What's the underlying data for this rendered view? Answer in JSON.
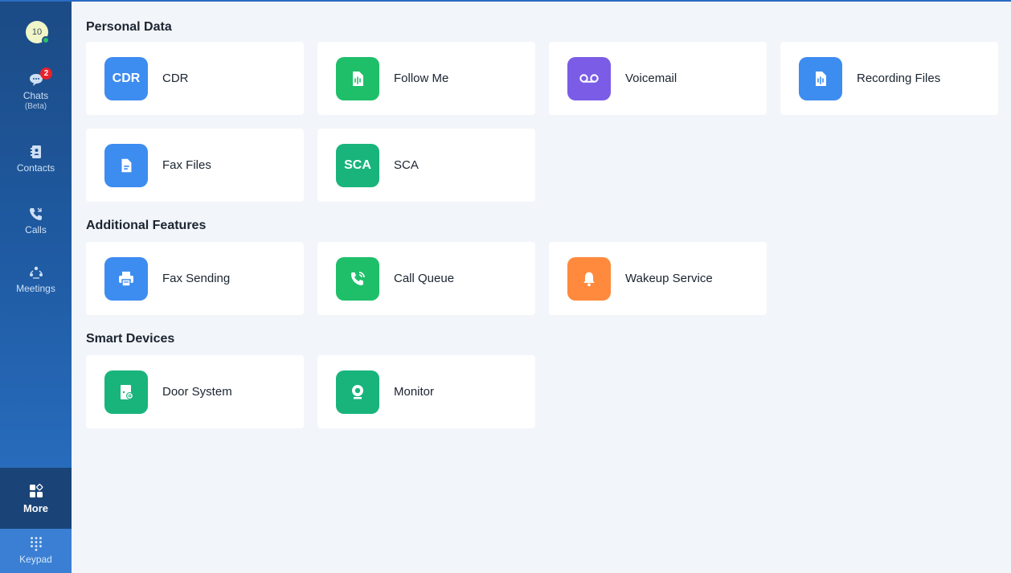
{
  "colors": {
    "blue": "#3d8cf0",
    "green": "#1fbf6a",
    "teal": "#18b47c",
    "purple": "#7b5ce6",
    "orange": "#ff8a3d"
  },
  "sidebar": {
    "avatar_text": "10",
    "chats": {
      "label": "Chats",
      "sub": "(Beta)",
      "badge": "2"
    },
    "contacts": {
      "label": "Contacts"
    },
    "calls": {
      "label": "Calls"
    },
    "meetings": {
      "label": "Meetings"
    },
    "more": {
      "label": "More"
    },
    "keypad": {
      "label": "Keypad"
    }
  },
  "sections": {
    "personal": {
      "title": "Personal Data",
      "items": [
        {
          "label": "CDR",
          "tile_text": "CDR",
          "icon": "cdr-text-icon",
          "color": "#3d8cf0"
        },
        {
          "label": "Follow Me",
          "icon": "follow-me-icon",
          "color": "#1fbf6a"
        },
        {
          "label": "Voicemail",
          "icon": "voicemail-icon",
          "color": "#7b5ce6"
        },
        {
          "label": "Recording Files",
          "icon": "recording-file-icon",
          "color": "#3d8cf0"
        },
        {
          "label": "Fax Files",
          "icon": "document-icon",
          "color": "#3d8cf0"
        },
        {
          "label": "SCA",
          "tile_text": "SCA",
          "icon": "sca-text-icon",
          "color": "#18b47c"
        }
      ]
    },
    "additional": {
      "title": "Additional Features",
      "items": [
        {
          "label": "Fax Sending",
          "icon": "printer-icon",
          "color": "#3d8cf0"
        },
        {
          "label": "Call Queue",
          "icon": "call-queue-icon",
          "color": "#1fbf6a"
        },
        {
          "label": "Wakeup Service",
          "icon": "bell-icon",
          "color": "#ff8a3d"
        }
      ]
    },
    "smart": {
      "title": "Smart Devices",
      "items": [
        {
          "label": "Door System",
          "icon": "door-icon",
          "color": "#18b47c"
        },
        {
          "label": "Monitor",
          "icon": "webcam-icon",
          "color": "#18b47c"
        }
      ]
    }
  }
}
